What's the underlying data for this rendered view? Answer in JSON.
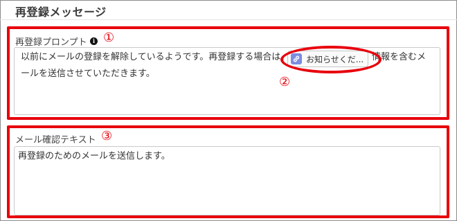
{
  "section": {
    "title": "再登録メッセージ"
  },
  "prompt_field": {
    "label": "再登録プロンプト",
    "marker": "①",
    "text_line1_start": "以前にメールの登録を解除しているようです。再登録する場合は、",
    "text_line1_end": "情報を含むメ",
    "text_line2": "ールを送信させていただきます。"
  },
  "link_chip": {
    "label": "お知らせくだ...",
    "icon": "link-icon",
    "marker": "②"
  },
  "confirm_field": {
    "label": "メール確認テキスト",
    "marker": "③",
    "text": "再登録のためのメールを送信します。"
  },
  "colors": {
    "highlight": "#e8000c",
    "chip_icon": "#7c8ce0"
  }
}
